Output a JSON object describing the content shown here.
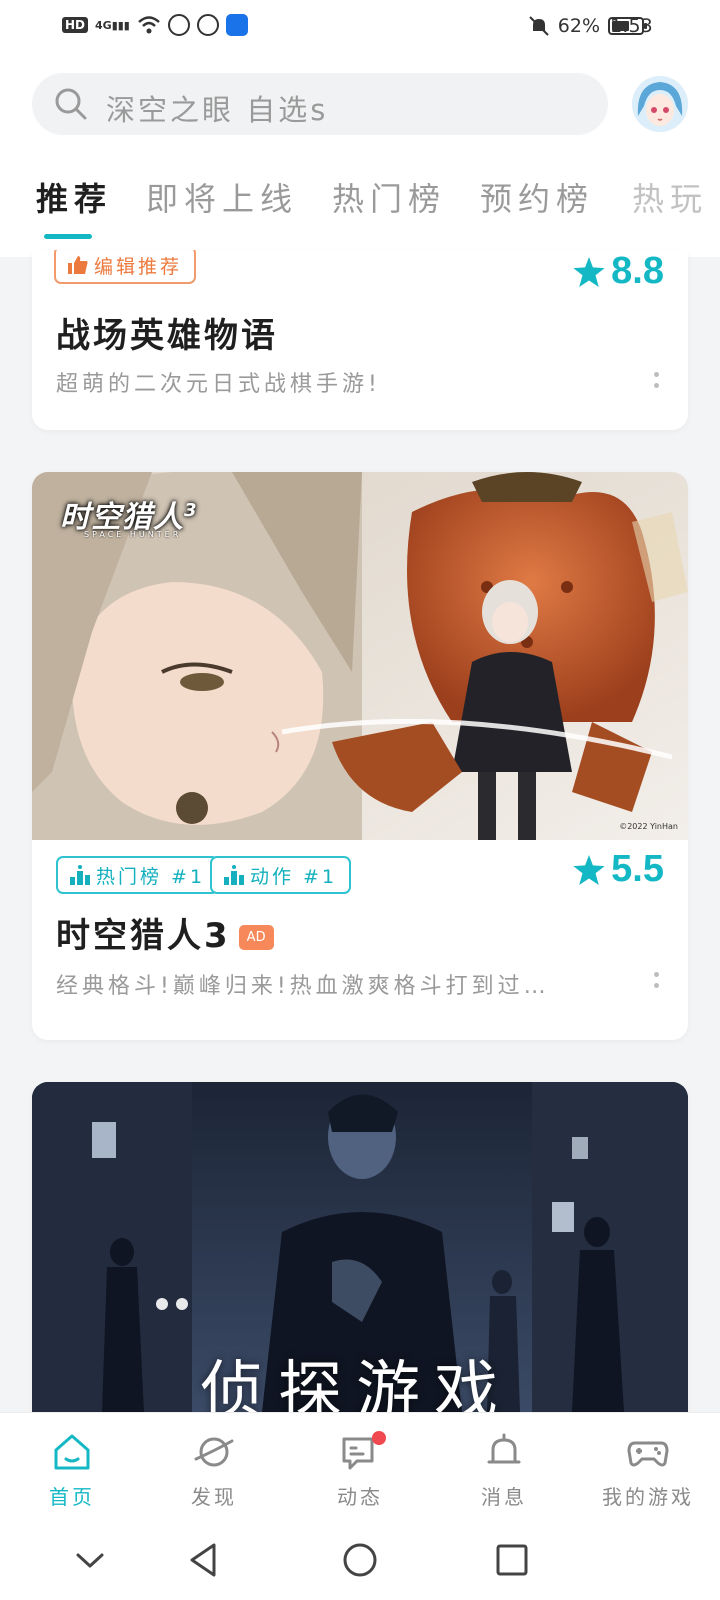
{
  "status_bar": {
    "hd": "HD",
    "network": "4G",
    "battery_percent": "62%",
    "battery_level": 0.62,
    "time": "1:53"
  },
  "search": {
    "placeholder": "深空之眼 自选s"
  },
  "tabs": [
    {
      "label": "推荐",
      "active": true
    },
    {
      "label": "即将上线",
      "active": false
    },
    {
      "label": "热门榜",
      "active": false
    },
    {
      "label": "预约榜",
      "active": false
    },
    {
      "label": "热玩",
      "active": false
    }
  ],
  "cards": [
    {
      "tags": [
        {
          "label": "编辑推荐",
          "icon": "thumbs-up-icon"
        }
      ],
      "rating": "8.8",
      "title": "战场英雄物语",
      "description": "超萌的二次元日式战棋手游!"
    },
    {
      "banner_logo": "时空猎人",
      "banner_logo_num": "3",
      "banner_logo_sub": "SPACE HUNTER",
      "banner_copyright": "©2022 YinHan",
      "tags": [
        {
          "label": "热门榜 #1",
          "icon": "rank-icon"
        },
        {
          "label": "动作 #1",
          "icon": "rank-icon"
        }
      ],
      "rating": "5.5",
      "title": "时空猎人3",
      "ad_label": "AD",
      "description": "经典格斗!巅峰归来!热血激爽格斗打到过…"
    },
    {
      "banner_title": "侦探游戏"
    }
  ],
  "bottom_nav": [
    {
      "label": "首页",
      "icon": "home-icon",
      "active": true
    },
    {
      "label": "发现",
      "icon": "planet-icon",
      "active": false
    },
    {
      "label": "动态",
      "icon": "message-icon",
      "active": false,
      "badge": true
    },
    {
      "label": "消息",
      "icon": "bell-icon",
      "active": false
    },
    {
      "label": "我的游戏",
      "icon": "gamepad-icon",
      "active": false
    }
  ],
  "colors": {
    "accent": "#14b8c5",
    "orange_tag": "#ec7a3e",
    "ad_badge": "#f6885a",
    "notification_dot": "#f0494f"
  }
}
